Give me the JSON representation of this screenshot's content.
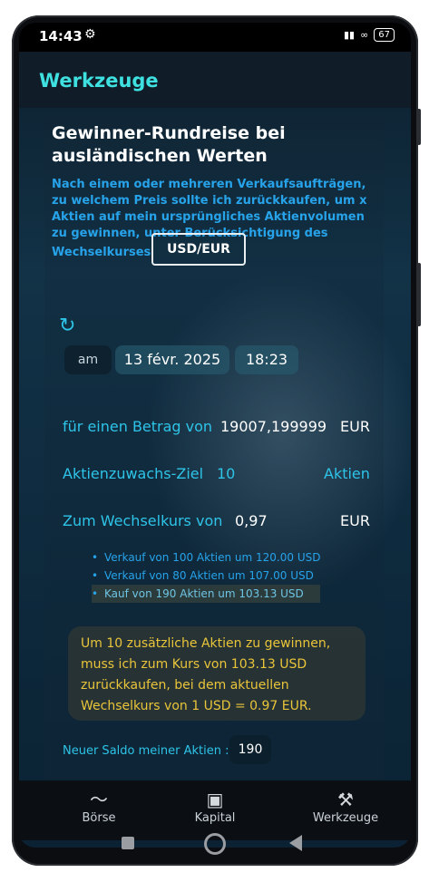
{
  "status": {
    "time": "14:43",
    "battery": "67"
  },
  "appbar": {
    "title": "Werkzeuge"
  },
  "tool": {
    "heading": "Gewinner-Rundreise bei ausländischen Werten",
    "description": "Nach einem oder mehreren Verkaufsaufträgen, zu welchem Preis sollte ich zurückkaufen, um x Aktien auf mein ursprüngliches Aktienvolumen zu gewinnen, unter Berücksichtigung des",
    "description_tail": "Wechselkurses",
    "currency_pair": "USD/EUR"
  },
  "datetime": {
    "prefix": "am",
    "date": "13 févr. 2025",
    "time": "18:23"
  },
  "fields": {
    "amount_label": "für einen Betrag von",
    "amount_value": "19007,199999",
    "amount_unit": "EUR",
    "target_label": "Aktienzuwachs-Ziel",
    "target_value": "10",
    "target_unit": "Aktien",
    "rate_label": "Zum Wechselkurs von",
    "rate_value": "0,97",
    "rate_unit": "EUR"
  },
  "orders": [
    "Verkauf von 100 Aktien um 120.00 USD",
    "Verkauf von 80 Aktien um 107.00 USD",
    "Kauf von 190 Aktien um 103.13 USD"
  ],
  "result": "Um 10 zusätzliche Aktien zu gewinnen, muss ich zum Kurs von 103.13 USD zurückkaufen, bei dem aktuellen Wechselkurs von 1 USD = 0.97 EUR.",
  "saldo": {
    "label": "Neuer Saldo meiner Aktien :",
    "value": "190"
  },
  "nav": {
    "borse": "Börse",
    "kapital": "Kapital",
    "werkzeuge": "Werkzeuge"
  }
}
